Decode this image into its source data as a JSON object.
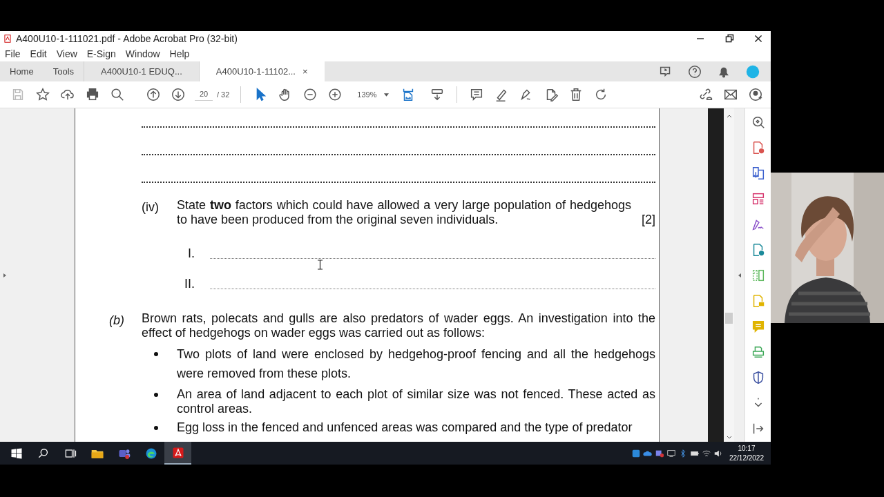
{
  "window": {
    "title": "A400U10-1-111021.pdf - Adobe Acrobat Pro (32-bit)"
  },
  "menu": [
    "File",
    "Edit",
    "View",
    "E-Sign",
    "Window",
    "Help"
  ],
  "tabs": [
    {
      "label": "Home",
      "kind": "nav",
      "selected": false
    },
    {
      "label": "Tools",
      "kind": "nav",
      "selected": false
    },
    {
      "label": "A400U10-1 EDUQ...",
      "kind": "doc",
      "selected": false
    },
    {
      "label": "A400U10-1-11102...",
      "kind": "doc",
      "selected": true,
      "close": "×"
    }
  ],
  "toolbar": {
    "page": "20",
    "page_total": "/ 32",
    "zoom": "139%"
  },
  "document": {
    "question": {
      "number": "(iv)",
      "text": "State **two** factors which could have allowed a very large population of hedgehogs to have been produced from the original seven individuals.",
      "marks": "[2]",
      "answers": [
        "I.",
        "II."
      ]
    },
    "part": {
      "label": "(b)",
      "text": "Brown rats, polecats and gulls are also predators of wader eggs. An investigation into the effect of hedgehogs on wader eggs was carried out as follows:",
      "bullets": [
        "Two plots of land were enclosed by hedgehog-proof fencing and all the hedgehogs were removed from these plots.",
        "An area of land adjacent to each plot of similar size was not fenced. These acted as control areas.",
        "Egg loss in the fenced and unfenced areas was compared and the type of predator"
      ]
    }
  },
  "taskbar": {
    "time": "10:17",
    "date": "22/12/2022"
  }
}
